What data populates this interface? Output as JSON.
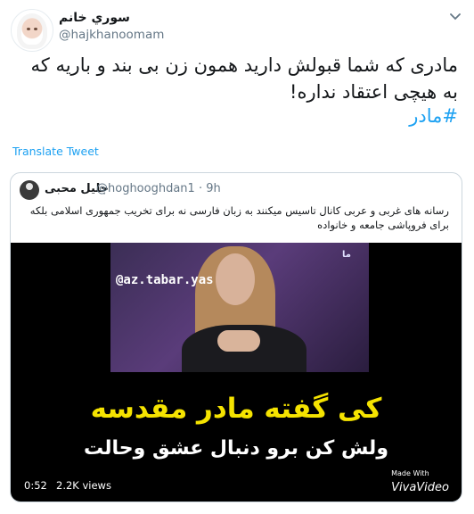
{
  "tweet": {
    "author_name": "سوري خانم",
    "author_handle": "@hajkhanoomam",
    "text": "مادری که شما قبولش دارید همون زن بی بند و باریه که به هیچی اعتقاد نداره!",
    "hashtag": "#مادر",
    "translate_label": "Translate Tweet"
  },
  "quoted": {
    "author_name": "جلیل محبی",
    "author_handle": "@hoghooghdan1 · 9h",
    "text": "رسانه های غربی و عربی کانال تاسیس میکنند به زبان فارسی نه برای تخریب جمهوری اسلامی بلکه برای فروپاشی جامعه و خانواده",
    "video": {
      "watermark": "@az.tabar.yas",
      "channel_tag": "ما",
      "caption_line1": "کی گفته مادر مقدسه",
      "caption_line2": "ولش کن برو دنبال عشق وحالت",
      "duration": "0:52",
      "views": "2.2K views",
      "made_with": "Made With",
      "brand": "VivaVideo"
    }
  },
  "icons": {
    "more": "chevron-down-icon"
  },
  "colors": {
    "link": "#1da1f2",
    "muted": "#657786",
    "caption_yellow": "#f5e300"
  }
}
